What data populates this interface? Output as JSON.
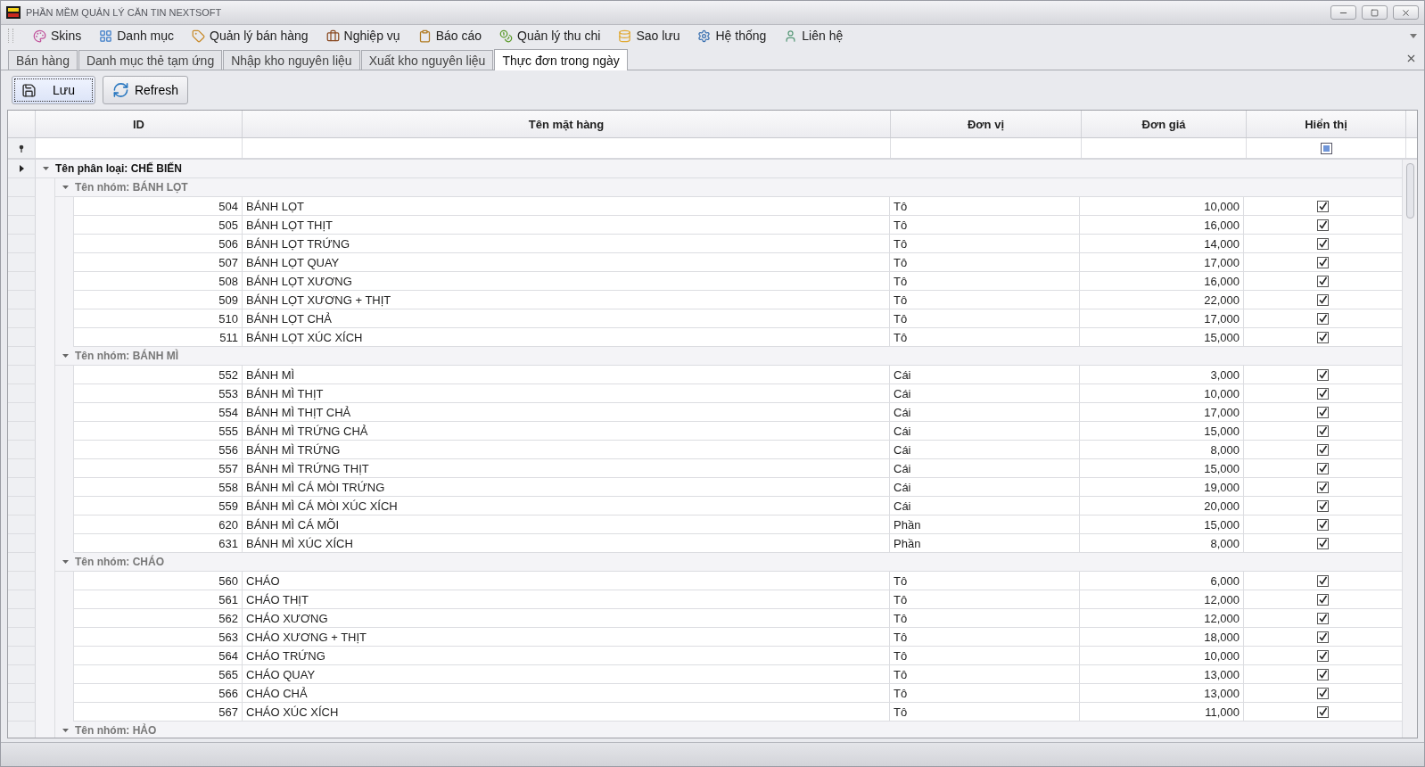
{
  "window": {
    "title": "PHẦN MỀM QUẢN LÝ CĂN TIN NEXTSOFT"
  },
  "menu": [
    {
      "label": "Skins"
    },
    {
      "label": "Danh mục"
    },
    {
      "label": "Quản lý bán hàng"
    },
    {
      "label": "Nghiệp vụ"
    },
    {
      "label": "Báo cáo"
    },
    {
      "label": "Quản lý thu chi"
    },
    {
      "label": "Sao lưu"
    },
    {
      "label": "Hệ thống"
    },
    {
      "label": "Liên hệ"
    }
  ],
  "tabs": [
    {
      "label": "Bán hàng",
      "selected": false
    },
    {
      "label": "Danh mục thẻ tạm ứng",
      "selected": false
    },
    {
      "label": "Nhập kho nguyên liệu",
      "selected": false
    },
    {
      "label": "Xuất kho nguyên liệu",
      "selected": false
    },
    {
      "label": "Thực đơn trong ngày",
      "selected": true
    }
  ],
  "toolbar": [
    {
      "label": "Lưu",
      "kind": "save",
      "focused": true
    },
    {
      "label": "Refresh",
      "kind": "refresh",
      "focused": false
    }
  ],
  "table": {
    "columns": [
      "ID",
      "Tên mặt hàng",
      "Đơn vị",
      "Đơn giá",
      "Hiển thị"
    ],
    "categories": [
      {
        "label": "Tên phân loại: CHẾ BIẾN",
        "expanded": true,
        "focused": true,
        "groups": [
          {
            "label": "Tên nhóm: BÁNH LỌT",
            "expanded": true,
            "rows": [
              {
                "id": "504",
                "name": "BÁNH LỌT",
                "unit": "Tô",
                "price": "10,000",
                "visible": true
              },
              {
                "id": "505",
                "name": "BÁNH LỌT THỊT",
                "unit": "Tô",
                "price": "16,000",
                "visible": true
              },
              {
                "id": "506",
                "name": "BÁNH LỌT TRỨNG",
                "unit": "Tô",
                "price": "14,000",
                "visible": true
              },
              {
                "id": "507",
                "name": "BÁNH LỌT QUAY",
                "unit": "Tô",
                "price": "17,000",
                "visible": true
              },
              {
                "id": "508",
                "name": "BÁNH LỌT XƯƠNG",
                "unit": "Tô",
                "price": "16,000",
                "visible": true
              },
              {
                "id": "509",
                "name": "BÁNH LỌT XƯƠNG + THỊT",
                "unit": "Tô",
                "price": "22,000",
                "visible": true
              },
              {
                "id": "510",
                "name": "BÁNH LỌT CHẢ",
                "unit": "Tô",
                "price": "17,000",
                "visible": true
              },
              {
                "id": "511",
                "name": "BÁNH LỌT XÚC XÍCH",
                "unit": "Tô",
                "price": "15,000",
                "visible": true
              }
            ]
          },
          {
            "label": "Tên nhóm: BÁNH MÌ",
            "expanded": true,
            "rows": [
              {
                "id": "552",
                "name": "BÁNH MÌ",
                "unit": "Cái",
                "price": "3,000",
                "visible": true
              },
              {
                "id": "553",
                "name": "BÁNH MÌ THỊT",
                "unit": "Cái",
                "price": "10,000",
                "visible": true
              },
              {
                "id": "554",
                "name": "BÁNH MÌ THỊT CHẢ",
                "unit": "Cái",
                "price": "17,000",
                "visible": true
              },
              {
                "id": "555",
                "name": "BÁNH MÌ TRỨNG CHẢ",
                "unit": "Cái",
                "price": "15,000",
                "visible": true
              },
              {
                "id": "556",
                "name": "BÁNH MÌ TRỨNG",
                "unit": "Cái",
                "price": "8,000",
                "visible": true
              },
              {
                "id": "557",
                "name": "BÁNH MÌ TRỨNG THỊT",
                "unit": "Cái",
                "price": "15,000",
                "visible": true
              },
              {
                "id": "558",
                "name": "BÁNH MÌ CÁ MÒI TRỨNG",
                "unit": "Cái",
                "price": "19,000",
                "visible": true
              },
              {
                "id": "559",
                "name": "BÁNH MÌ CÁ MÒI XÚC XÍCH",
                "unit": "Cái",
                "price": "20,000",
                "visible": true
              },
              {
                "id": "620",
                "name": "BÁNH MÌ CÁ MÕI",
                "unit": "Phần",
                "price": "15,000",
                "visible": true
              },
              {
                "id": "631",
                "name": "BÁNH MÌ XÚC XÍCH",
                "unit": "Phần",
                "price": "8,000",
                "visible": true
              }
            ]
          },
          {
            "label": "Tên nhóm: CHÁO",
            "expanded": true,
            "rows": [
              {
                "id": "560",
                "name": "CHÁO",
                "unit": "Tô",
                "price": "6,000",
                "visible": true
              },
              {
                "id": "561",
                "name": "CHÁO THỊT",
                "unit": "Tô",
                "price": "12,000",
                "visible": true
              },
              {
                "id": "562",
                "name": "CHÁO XƯƠNG",
                "unit": "Tô",
                "price": "12,000",
                "visible": true
              },
              {
                "id": "563",
                "name": "CHÁO XƯƠNG + THỊT",
                "unit": "Tô",
                "price": "18,000",
                "visible": true
              },
              {
                "id": "564",
                "name": "CHÁO TRỨNG",
                "unit": "Tô",
                "price": "10,000",
                "visible": true
              },
              {
                "id": "565",
                "name": "CHÁO QUAY",
                "unit": "Tô",
                "price": "13,000",
                "visible": true
              },
              {
                "id": "566",
                "name": "CHÁO CHẢ",
                "unit": "Tô",
                "price": "13,000",
                "visible": true
              },
              {
                "id": "567",
                "name": "CHÁO XÚC XÍCH",
                "unit": "Tô",
                "price": "11,000",
                "visible": true
              }
            ]
          },
          {
            "label": "Tên nhóm: HẢO",
            "expanded": true
          }
        ]
      }
    ]
  }
}
